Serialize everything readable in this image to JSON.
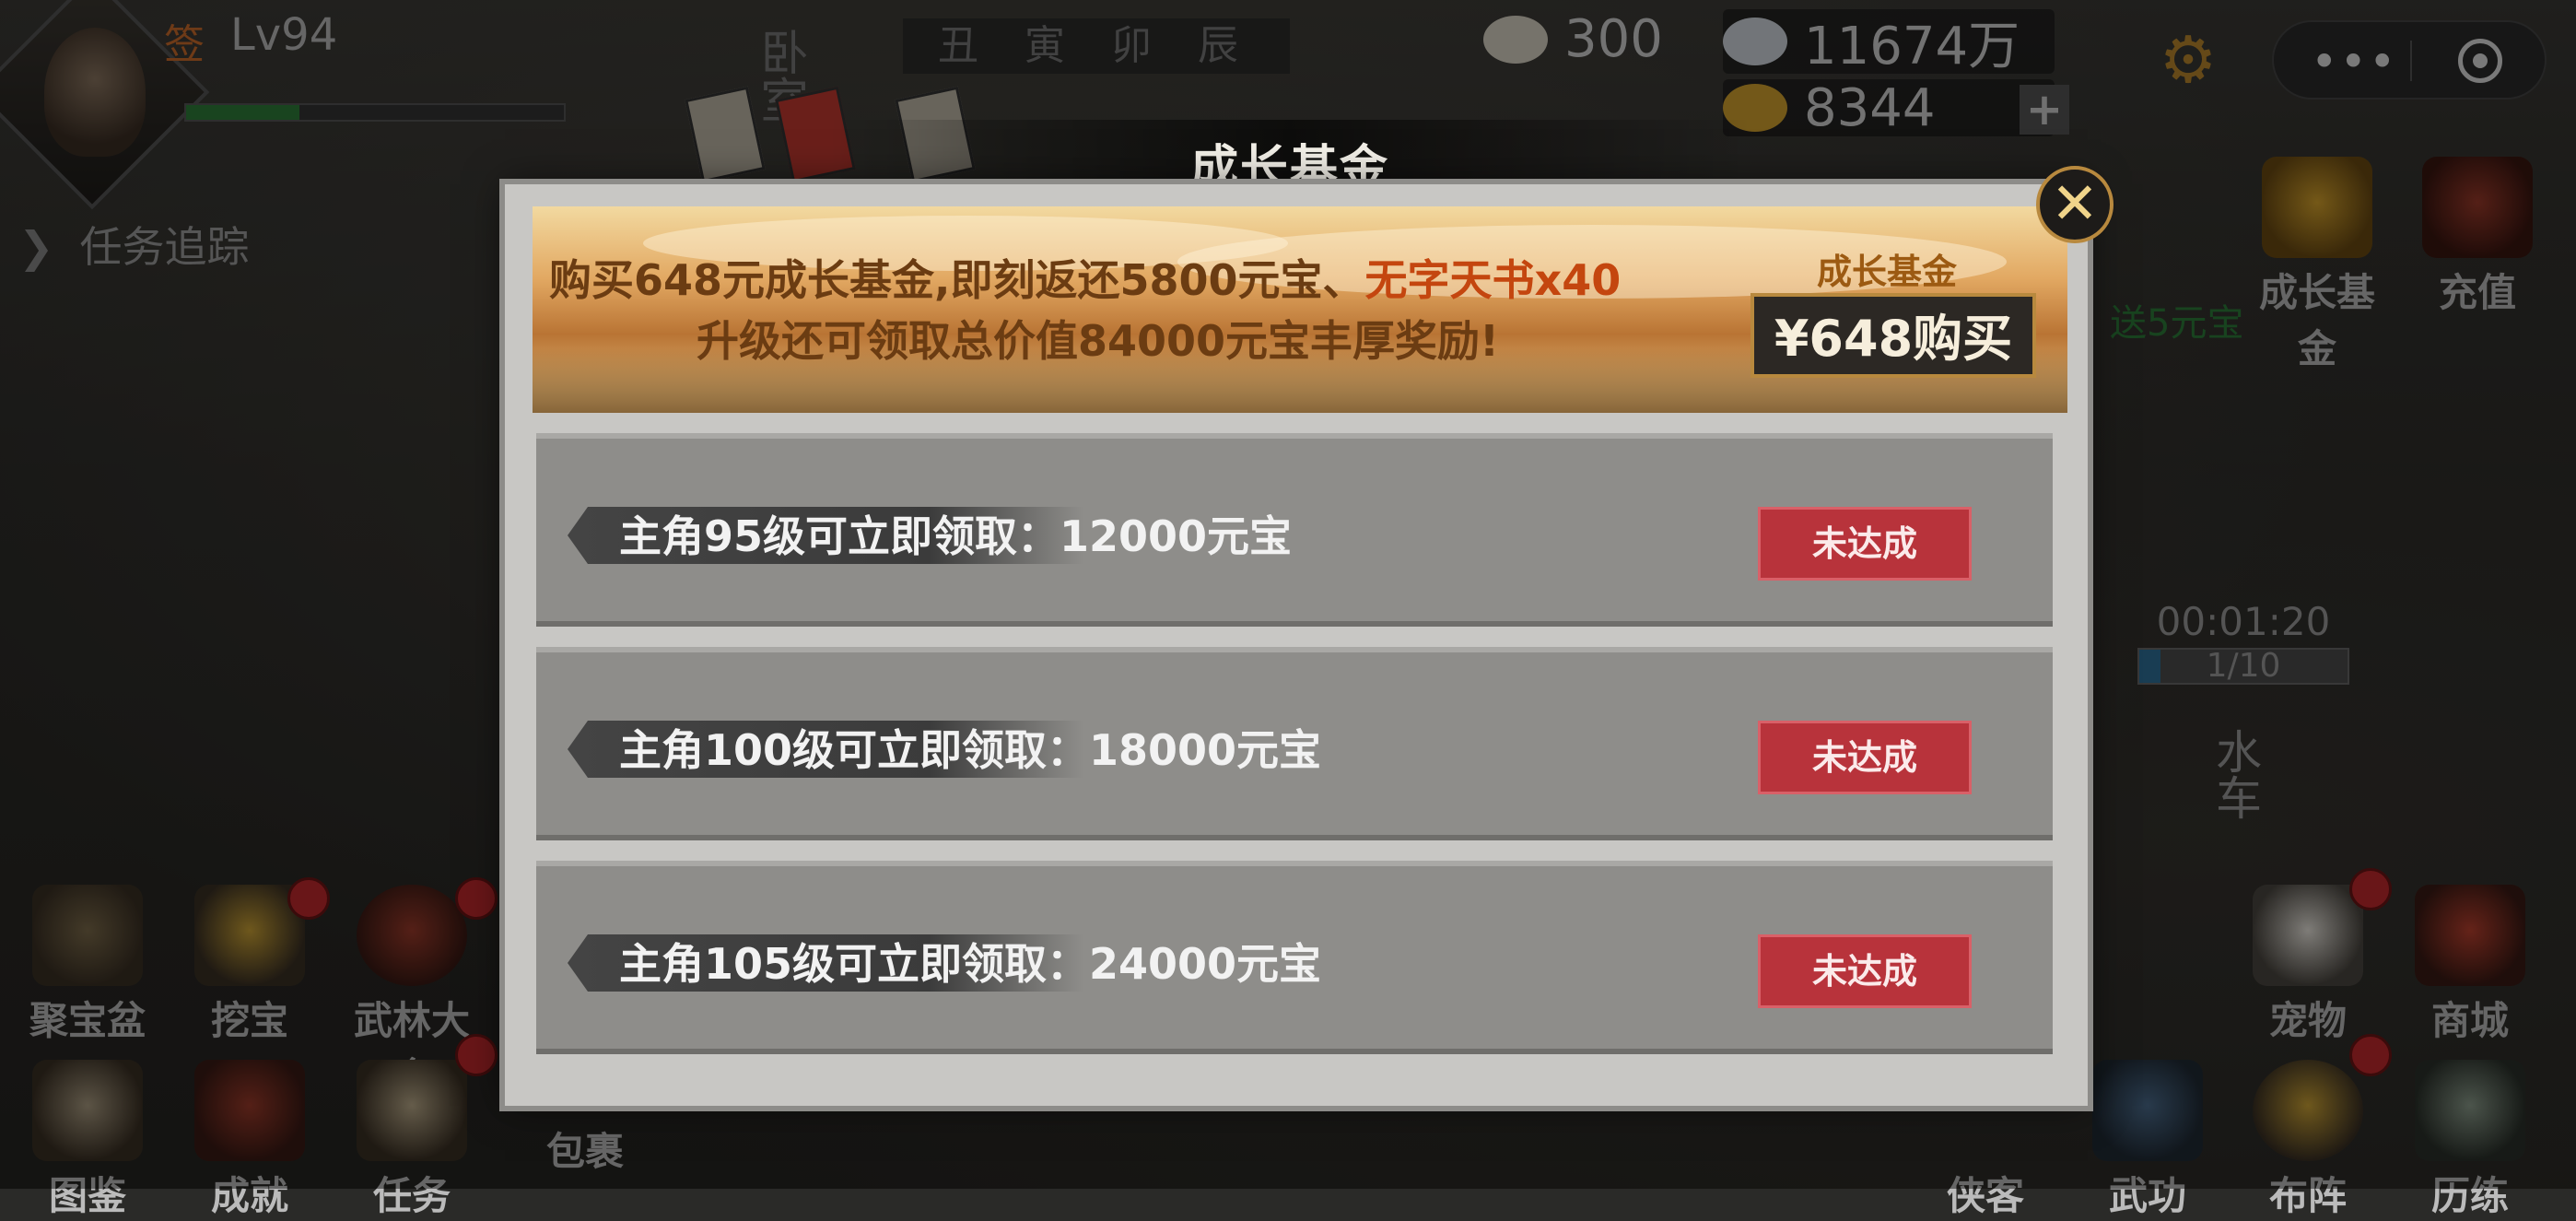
{
  "player": {
    "sign": "签",
    "level": "Lv94",
    "hp_fraction": 0.3
  },
  "quest_tracker": "任务追踪",
  "room_label": "卧室",
  "time_slots": "丑 寅 卯 辰",
  "resources": {
    "buns": "300",
    "silver": "11674万",
    "gold": "8344",
    "add": "+"
  },
  "right_icons": {
    "growth_fund": "成长基金",
    "recharge": "充值"
  },
  "hint_green": "送5元宝",
  "timer": {
    "time": "00:01:20",
    "progress_text": "1/10",
    "progress_fraction": 0.1
  },
  "location": "水车",
  "left_icons": [
    "聚宝盆",
    "挖宝",
    "武林大会",
    "图鉴",
    "成就",
    "任务",
    "包裹"
  ],
  "bottom_right_icons": [
    "宠物",
    "商城",
    "侠客",
    "武功",
    "布阵",
    "历练"
  ],
  "modal": {
    "title": "成长基金",
    "close": "✕",
    "banner_line1_a": "购买648元成长基金,即刻返还5800元宝、",
    "banner_line1_b": "无字天书x40",
    "banner_line2": "升级还可领取总价值84000元宝丰厚奖励!",
    "fund_label": "成长基金",
    "buy_button": "¥648购买",
    "rows": [
      {
        "text": "主角95级可立即领取：12000元宝",
        "status": "未达成"
      },
      {
        "text": "主角100级可立即领取：18000元宝",
        "status": "未达成"
      },
      {
        "text": "主角105级可立即领取：24000元宝",
        "status": "未达成"
      }
    ]
  },
  "colors": {
    "status_red": "#b8333b",
    "gold_border": "#b8893e",
    "highlight_orange": "#c4460f"
  }
}
